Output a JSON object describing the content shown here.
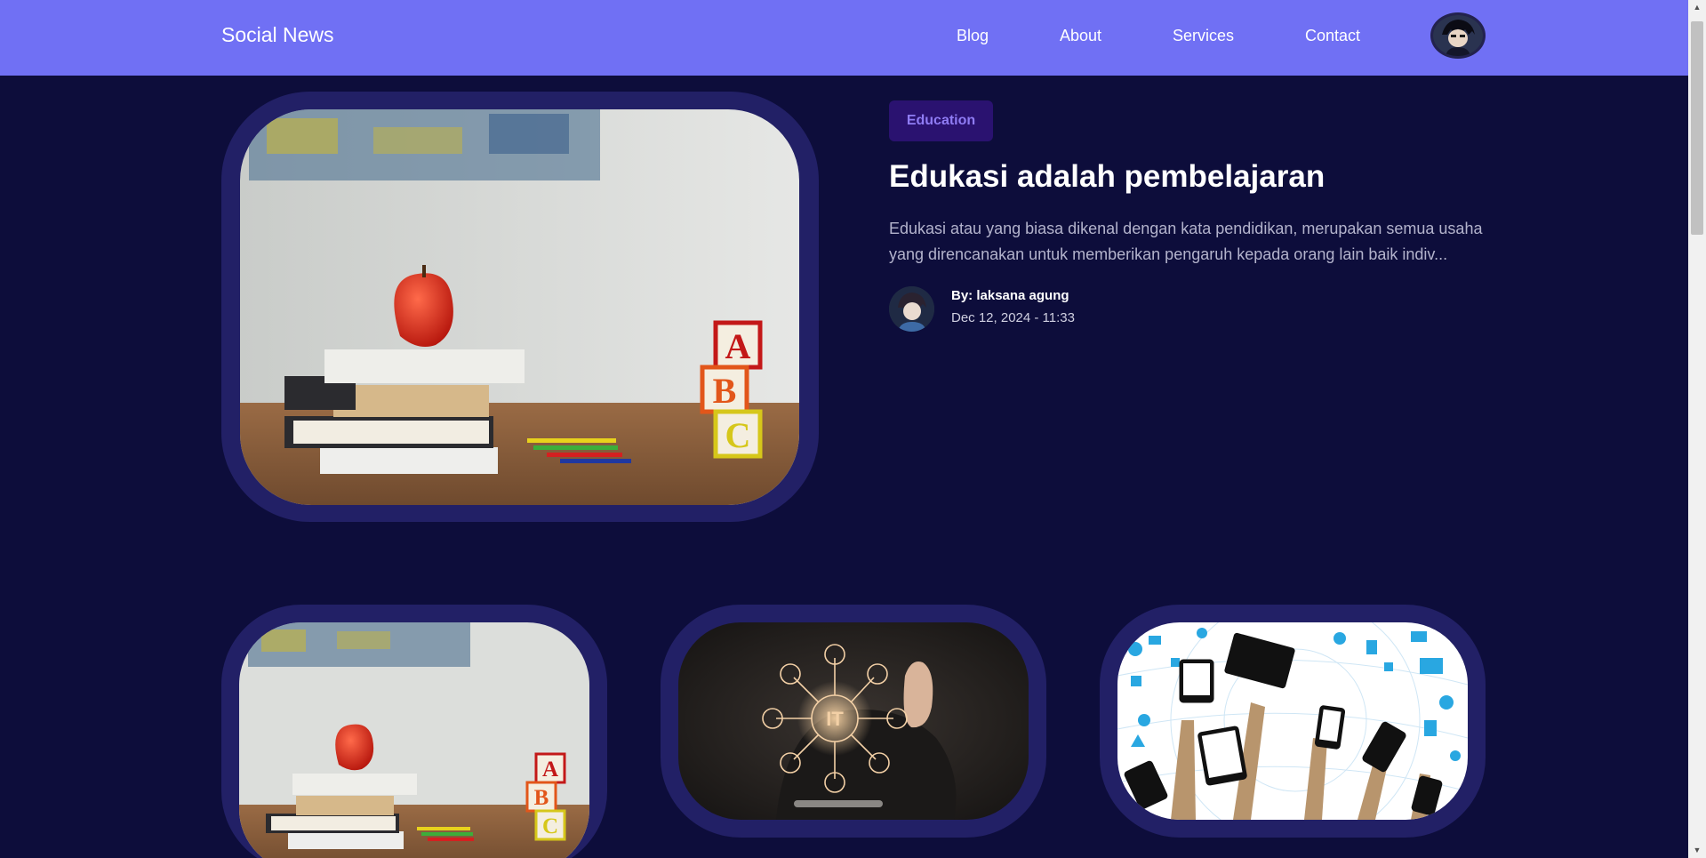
{
  "header": {
    "brand": "Social News",
    "nav": [
      {
        "label": "Blog"
      },
      {
        "label": "About"
      },
      {
        "label": "Services"
      },
      {
        "label": "Contact"
      }
    ],
    "avatar_icon": "user-avatar-icon"
  },
  "featured": {
    "category": "Education",
    "title": "Edukasi adalah pembelajaran",
    "excerpt": "Edukasi atau yang biasa dikenal dengan kata pendidikan, merupakan semua usaha yang direncanakan untuk memberikan pengaruh kepada orang lain baik indiv...",
    "author": "By: laksana agung",
    "date": "Dec 12, 2024 - 11:33",
    "image_icon": "books-apple-abc-image"
  },
  "cards": [
    {
      "image_icon": "books-apple-abc-image"
    },
    {
      "image_label": "IT"
    },
    {
      "image_icon": "devices-network-image"
    }
  ],
  "colors": {
    "navbar": "#7070f4",
    "background": "#0d0d3b",
    "frame": "#222066",
    "badge_bg": "#2a1270",
    "badge_text": "#8f7cf4"
  }
}
